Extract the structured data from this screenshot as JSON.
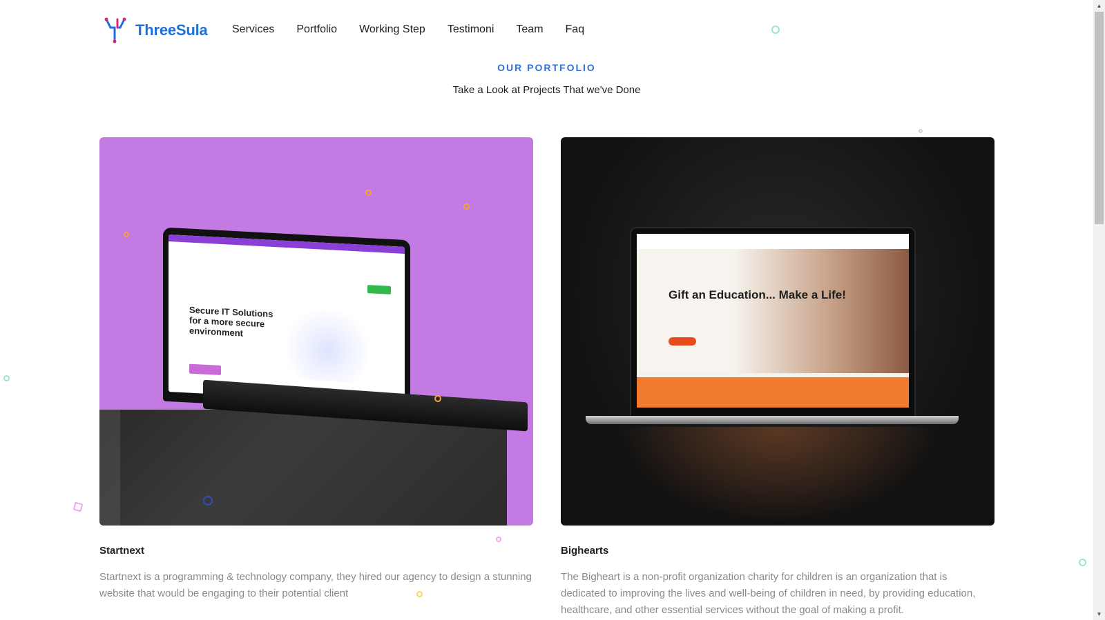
{
  "brand": {
    "name": "ThreeSula",
    "accent": "#1e6fd9"
  },
  "nav": {
    "items": [
      {
        "label": "Services"
      },
      {
        "label": "Portfolio"
      },
      {
        "label": "Working Step"
      },
      {
        "label": "Testimoni"
      },
      {
        "label": "Team"
      },
      {
        "label": "Faq"
      }
    ]
  },
  "section": {
    "eyebrow": "OUR PORTFOLIO",
    "subtitle": "Take a Look at Projects That we've Done"
  },
  "projects": [
    {
      "title": "Startnext",
      "description": "Startnext is a programming & technology company, they hired our agency to design a stunning website that would be engaging to their potential client",
      "mockup_headline": "Secure IT Solutions for a more secure environment",
      "background": "#c47ae3"
    },
    {
      "title": "Bighearts",
      "description": "The Bigheart is a non-profit organization charity for children is an organization that is dedicated to improving the lives and well-being of children in need, by providing education, healthcare, and other essential services without the goal of making a profit.",
      "mockup_headline": "Gift an Education... Make a Life!",
      "background": "#111111"
    }
  ]
}
